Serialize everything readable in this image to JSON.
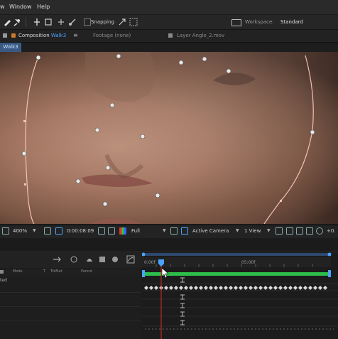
{
  "menu": [
    "w",
    "Window",
    "Help"
  ],
  "toolbar": {
    "snapping_label": "Snapping",
    "workspace_label": "Workspace:",
    "workspace_value": "Standard"
  },
  "tabs": {
    "composition_prefix": "Composition",
    "composition_name": "Walk3",
    "footage_label": "Footage (none)",
    "layer_label": "Layer Angle_2.mov",
    "comp_badge": "Walk3"
  },
  "viewer_controls": {
    "zoom": "400%",
    "timecode": "0:00:08:09",
    "resolution": "Full",
    "camera": "Active Camera",
    "view_count": "1 View",
    "offset": "+0."
  },
  "timeline": {
    "ruler_start": "0:00f",
    "ruler_mid": "05:00f",
    "layer_columns": [
      "Mode",
      "T",
      "TrkMat",
      "Parent"
    ],
    "layer_text": "ted"
  },
  "colors": {
    "accent": "#4aa3ff",
    "work_area": "#2dbd4a",
    "playhead": "#d9302a",
    "mask_path": "#f3c0b4"
  }
}
